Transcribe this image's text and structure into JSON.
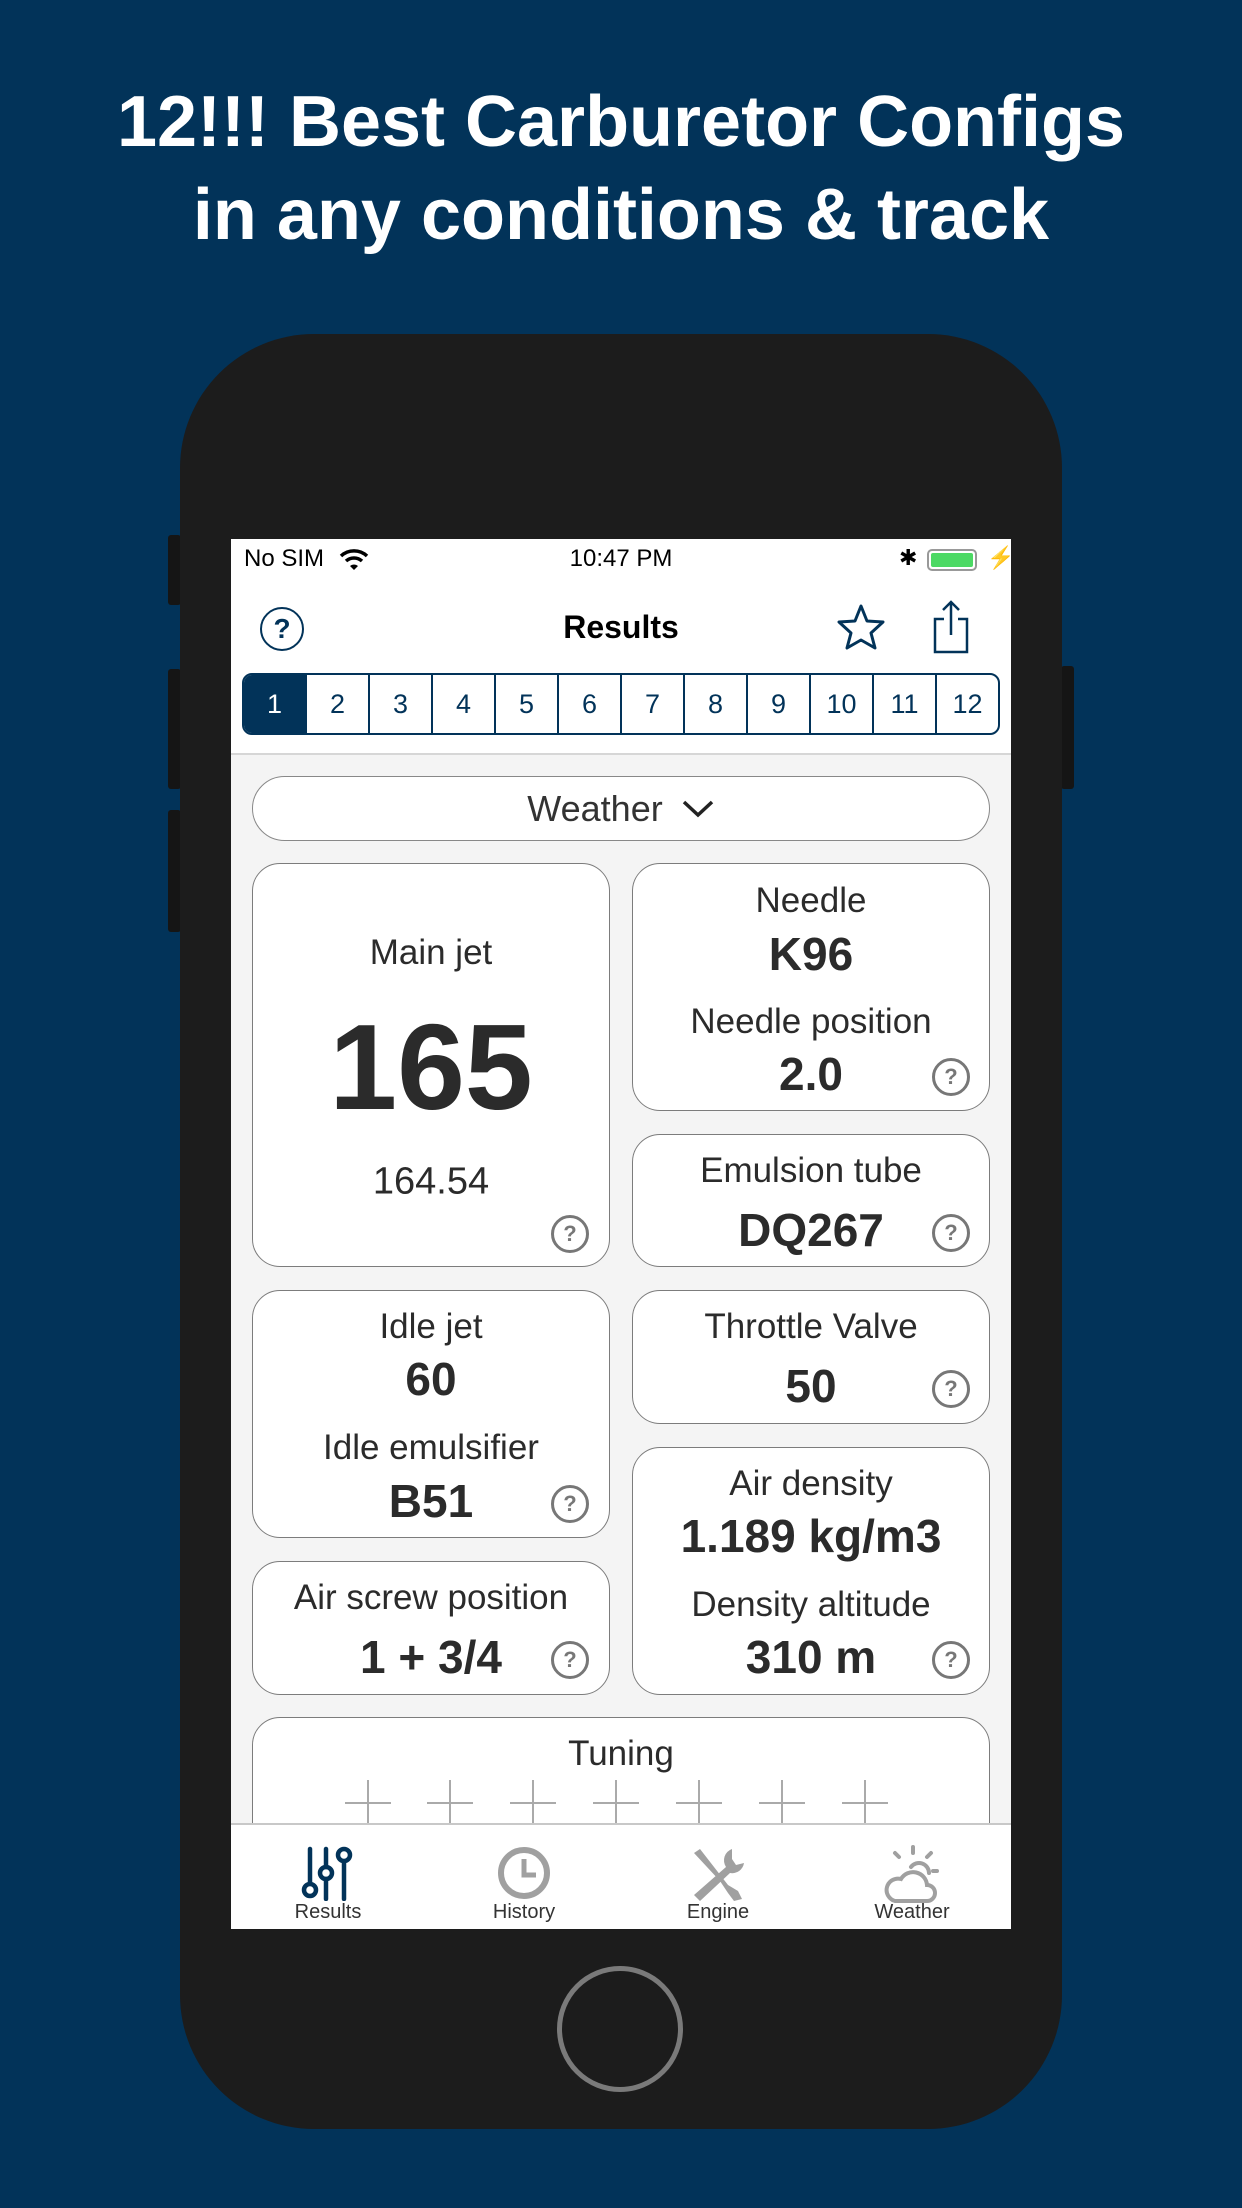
{
  "headline": {
    "line1": "12!!! Best Carburetor Configs",
    "line2": "in any conditions & track"
  },
  "status_bar": {
    "carrier": "No SIM",
    "time": "10:47 PM",
    "battery_color": "#4cd964"
  },
  "nav": {
    "title": "Results",
    "left_icon": "help-circle-icon",
    "right_icons": [
      "star-icon",
      "share-icon"
    ]
  },
  "segments": {
    "items": [
      "1",
      "2",
      "3",
      "4",
      "5",
      "6",
      "7",
      "8",
      "9",
      "10",
      "11",
      "12"
    ],
    "selected": "1"
  },
  "dropdown": {
    "label": "Weather"
  },
  "cards": {
    "main_jet": {
      "label": "Main jet",
      "value": "165",
      "exact": "164.54"
    },
    "needle": {
      "label": "Needle",
      "value": "K96",
      "label2": "Needle position",
      "value2": "2.0"
    },
    "emulsion_tube": {
      "label": "Emulsion tube",
      "value": "DQ267"
    },
    "idle_jet": {
      "label": "Idle jet",
      "value": "60",
      "label2": "Idle emulsifier",
      "value2": "B51"
    },
    "throttle_valve": {
      "label": "Throttle Valve",
      "value": "50"
    },
    "air_density": {
      "label": "Air density",
      "value": "1.189 kg/m3",
      "label2": "Density altitude",
      "value2": "310 m"
    },
    "air_screw": {
      "label": "Air screw position",
      "value": "1 + 3/4"
    },
    "tuning": {
      "label": "Tuning"
    }
  },
  "help_glyph": "?",
  "tabs": [
    {
      "label": "Results",
      "icon": "sliders-icon",
      "active": true
    },
    {
      "label": "History",
      "icon": "clock-icon",
      "active": false
    },
    {
      "label": "Engine",
      "icon": "wrench-screwdriver-icon",
      "active": false
    },
    {
      "label": "Weather",
      "icon": "sun-cloud-icon",
      "active": false
    }
  ],
  "colors": {
    "accent": "#023359",
    "background": "#023359",
    "inactive": "#a0a0a0"
  }
}
